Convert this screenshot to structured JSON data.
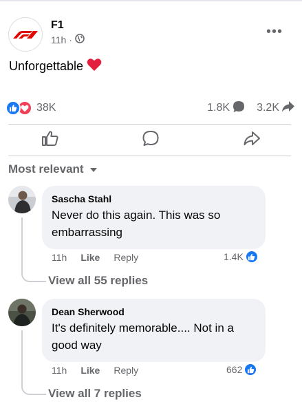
{
  "post": {
    "page_name": "F1",
    "time": "11h",
    "dot": "·",
    "text": "Unforgettable",
    "reactions_count": "38K",
    "comments_count": "1.8K",
    "shares_count": "3.2K",
    "more_label": "•••"
  },
  "sort": {
    "label": "Most relevant"
  },
  "comments": [
    {
      "author": "Sascha Stahl",
      "text": "Never do this again. This was so embarrassing",
      "time": "11h",
      "like_label": "Like",
      "reply_label": "Reply",
      "likes": "1.4K",
      "view_replies": "View all 55 replies"
    },
    {
      "author": "Dean Sherwood",
      "text": "It's definitely memorable.... Not in a good way",
      "time": "11h",
      "like_label": "Like",
      "reply_label": "Reply",
      "likes": "662",
      "view_replies": "View all 7 replies"
    }
  ],
  "colors": {
    "like_blue": "#1877f2",
    "love_red": "#f33e58",
    "f1_red": "#e10600",
    "secondary_text": "#65676b",
    "bubble_bg": "#f0f2f5"
  },
  "icons": {
    "logo": "f1-logo",
    "audience": "globe-icon",
    "heart": "red-heart-emoji",
    "comment_stat": "comment-bubble-icon",
    "share_stat": "share-arrow-icon",
    "like_action": "thumbs-up-icon",
    "comment_action": "comment-icon",
    "share_action": "share-icon",
    "sort_caret": "caret-down-icon"
  }
}
